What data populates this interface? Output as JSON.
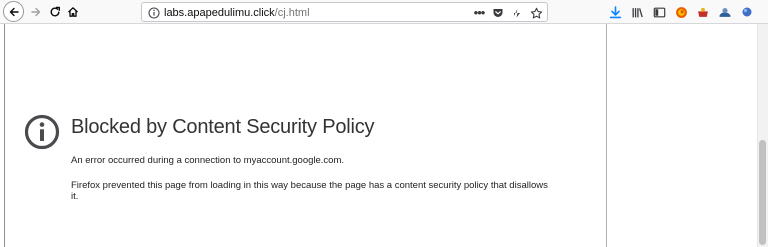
{
  "browser": {
    "nav": {
      "back_icon": "back-arrow-icon",
      "forward_icon": "forward-arrow-icon",
      "reload_icon": "reload-icon",
      "home_icon": "home-icon"
    },
    "urlbar": {
      "host": "labs.apapedulimu.click",
      "path": "/cj.html",
      "info_icon": "info-icon",
      "actions": [
        "page-actions-icon",
        "pocket-icon",
        "reader-icon",
        "bookmark-star-icon"
      ],
      "dots": "•••"
    },
    "toolbar_icons": [
      "download-icon",
      "library-icon",
      "sidebar-icon",
      "firefox-account-icon",
      "extension-icon",
      "screenshot-icon",
      "globe-icon",
      "menu-icon"
    ]
  },
  "error_page": {
    "title": "Blocked by Content Security Policy",
    "short_desc": "An error occurred during a connection to myaccount.google.com.",
    "long_desc": "Firefox prevented this page from loading in this way because the page has a content security policy that disallows it.",
    "icon": "info-icon"
  },
  "colors": {
    "accent": "#0a84ff",
    "icon_gray": "#4a4a4f",
    "error_icon": "#4a4a4f"
  }
}
